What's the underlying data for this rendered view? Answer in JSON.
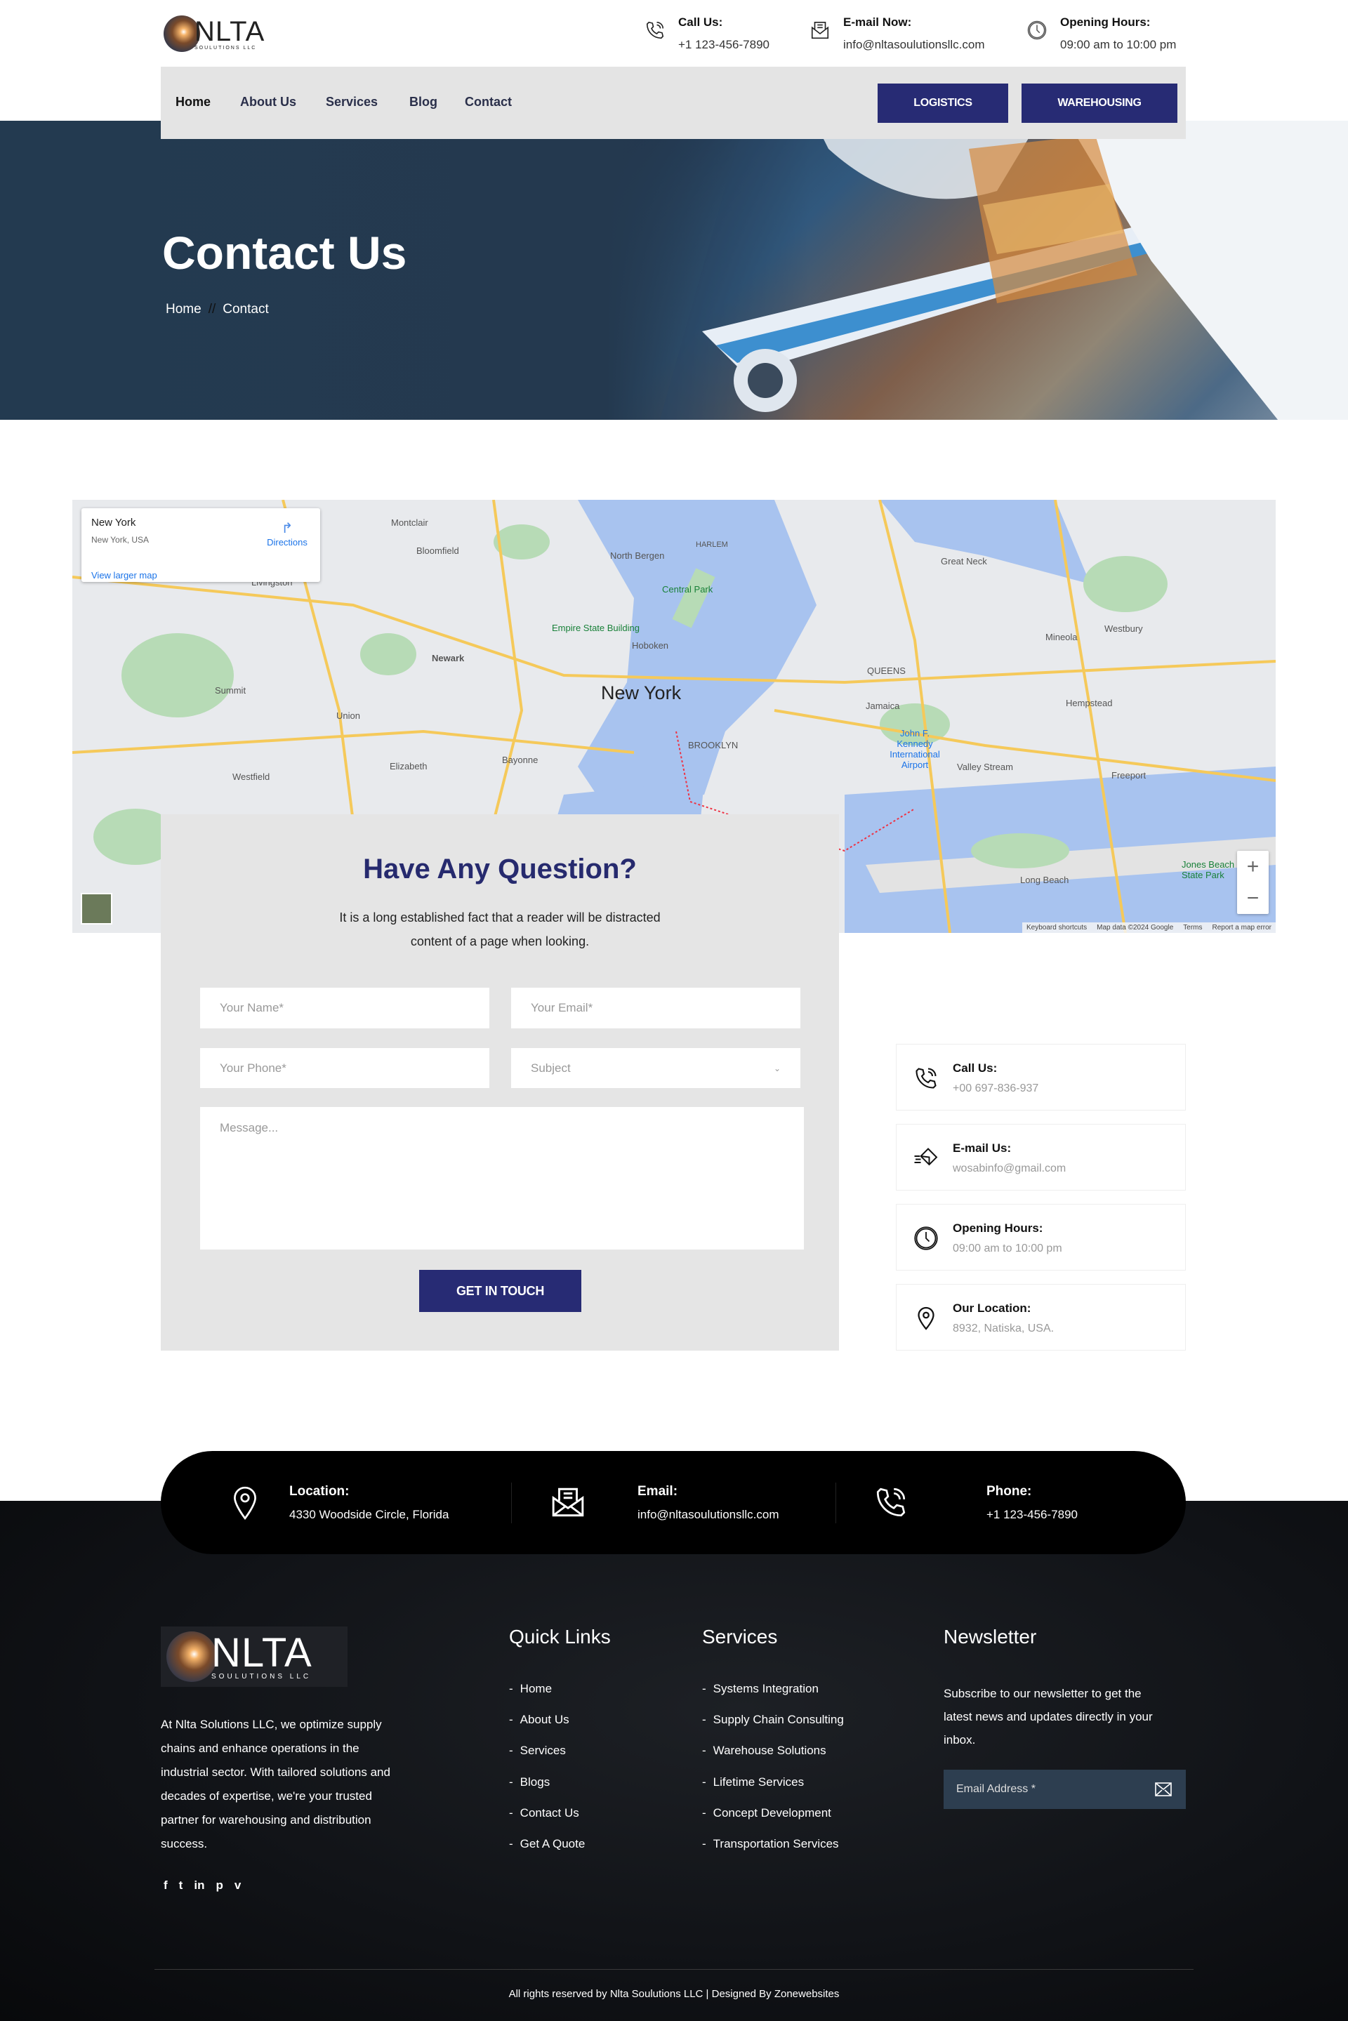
{
  "brand": {
    "logo_text": "NLTA",
    "logo_sub": "SOULUTIONS LLC"
  },
  "header": {
    "call_title": "Call Us:",
    "call_value": "+1 123-456-7890",
    "email_title": "E-mail Now:",
    "email_value": "info@nltasoulutionsllc.com",
    "hours_title": "Opening Hours:",
    "hours_value": "09:00 am to 10:00 pm"
  },
  "nav": {
    "items": [
      "Home",
      "About Us",
      "Services",
      "Blog",
      "Contact"
    ],
    "buttons": [
      "LOGISTICS",
      "WAREHOUSING"
    ],
    "accent": "#272b74"
  },
  "hero": {
    "title": "Contact Us",
    "breadcrumb": [
      "Home",
      "//",
      "Contact"
    ]
  },
  "map": {
    "place_title": "New York",
    "place_sub": "New York, USA",
    "directions": "Directions",
    "view_larger": "View larger map",
    "labels": [
      "New York",
      "Newark",
      "BROOKLYN",
      "QUEENS",
      "Hoboken",
      "Central Park",
      "Empire State Building",
      "Montclair",
      "Bloomfield",
      "Livingston",
      "Union",
      "Elizabeth",
      "Bayonne",
      "Westfield",
      "Summit",
      "Jamaica",
      "Long Beach",
      "Valley Stream",
      "Hempstead",
      "Mineola",
      "Westbury",
      "Freeport",
      "Great Neck",
      "HARLEM",
      "North Bergen",
      "John F. Kennedy International Airport",
      "Jones Beach State Park"
    ],
    "footer": [
      "Keyboard shortcuts",
      "Map data ©2024 Google",
      "Terms",
      "Report a map error"
    ],
    "zoom_in": "+",
    "zoom_out": "−"
  },
  "form": {
    "title": "Have Any Question?",
    "desc_line1": "It is a long established fact that a reader will be distracted",
    "desc_line2": "content of a page when looking.",
    "name_ph": "Your Name*",
    "email_ph": "Your Email*",
    "phone_ph": "Your Phone*",
    "subject_ph": "Subject",
    "message_ph": "Message...",
    "submit": "GET IN TOUCH"
  },
  "cards": [
    {
      "title": "Call Us:",
      "value": "+00 697-836-937",
      "icon": "phone-icon"
    },
    {
      "title": "E-mail Us:",
      "value": "wosabinfo@gmail.com",
      "icon": "mail-icon"
    },
    {
      "title": "Opening Hours:",
      "value": "09:00 am to 10:00 pm",
      "icon": "clock-icon"
    },
    {
      "title": "Our Location:",
      "value": "8932, Natiska, USA.",
      "icon": "location-icon"
    }
  ],
  "band": [
    {
      "title": "Location:",
      "value": "4330 Woodside Circle, Florida"
    },
    {
      "title": "Email:",
      "value": "info@nltasoulutionsllc.com"
    },
    {
      "title": "Phone:",
      "value": "+1 123-456-7890"
    }
  ],
  "footer": {
    "about": [
      "At Nlta Solutions LLC, we optimize supply",
      "chains and enhance operations in the",
      "industrial sector. With tailored solutions and",
      "decades of expertise, we're your trusted",
      "partner for warehousing and distribution",
      "success."
    ],
    "social": [
      "f",
      "t",
      "in",
      "p",
      "v"
    ],
    "quick_title": "Quick Links",
    "quick": [
      "Home",
      "About Us",
      "Services",
      "Blogs",
      "Contact Us",
      "Get A Quote"
    ],
    "services_title": "Services",
    "services": [
      "Systems Integration",
      "Supply Chain Consulting",
      "Warehouse Solutions",
      "Lifetime Services",
      "Concept Development",
      "Transportation Services"
    ],
    "news_title": "Newsletter",
    "news_text": [
      "Subscribe to our newsletter to get the",
      "latest news and updates directly in your",
      "inbox."
    ],
    "news_ph": "Email Address *",
    "copyright": "All rights reserved by Nlta Soulutions LLC | Designed By Zonewebsites"
  }
}
